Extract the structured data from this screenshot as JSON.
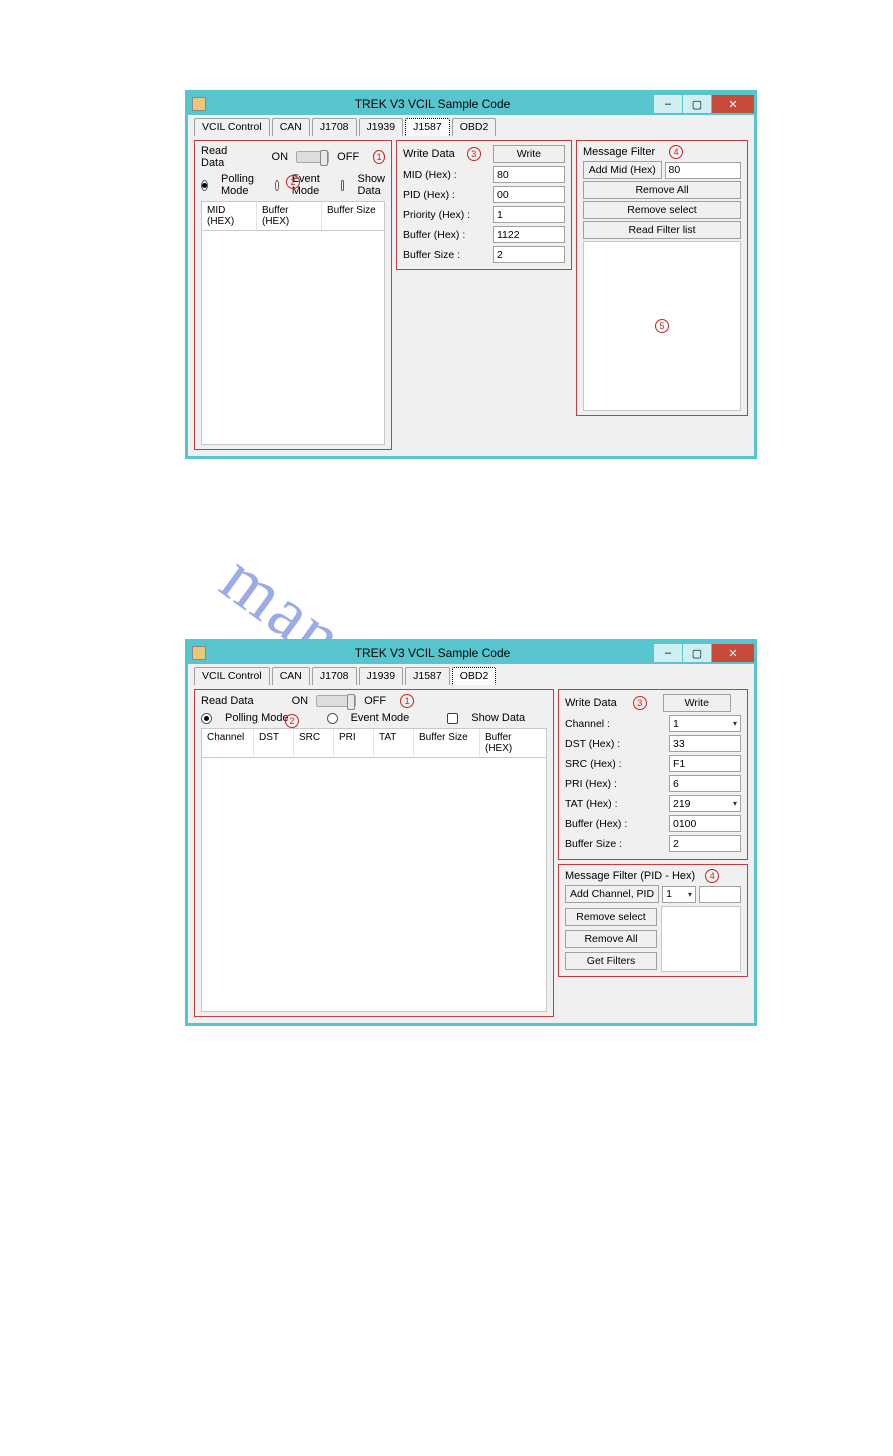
{
  "watermark": "manualshive.com",
  "common": {
    "window_title": "TREK V3 VCIL Sample Code",
    "minimize": "–",
    "maximize": "▢",
    "close": "✕",
    "tabs": [
      "VCIL Control",
      "CAN",
      "J1708",
      "J1939",
      "J1587",
      "OBD2"
    ],
    "on_label": "ON",
    "off_label": "OFF",
    "read_data": "Read Data",
    "polling_mode": "Polling Mode",
    "event_mode": "Event Mode",
    "show_data": "Show Data"
  },
  "win1": {
    "active_tab_index": 4,
    "headers": [
      "MID (HEX)",
      "Buffer (HEX)",
      "Buffer Size"
    ],
    "write_data": {
      "title": "Write Data",
      "write_btn": "Write",
      "fields": {
        "mid": {
          "label": "MID (Hex) :",
          "value": "80"
        },
        "pid": {
          "label": "PID (Hex) :",
          "value": "00"
        },
        "priority": {
          "label": "Priority (Hex) :",
          "value": "1"
        },
        "buffer": {
          "label": "Buffer (Hex) :",
          "value": "1122"
        },
        "buffer_size": {
          "label": "Buffer Size :",
          "value": "2"
        }
      }
    },
    "msg_filter": {
      "title": "Message Filter",
      "add_mid_btn": "Add Mid (Hex)",
      "add_mid_value": "80",
      "remove_all": "Remove All",
      "remove_select": "Remove select",
      "read_filter_list": "Read Filter list"
    },
    "annotations": [
      "1",
      "2",
      "3",
      "4",
      "5"
    ]
  },
  "win2": {
    "active_tab_index": 5,
    "headers": [
      "Channel",
      "DST",
      "SRC",
      "PRI",
      "TAT",
      "Buffer Size",
      "Buffer (HEX)"
    ],
    "write_data": {
      "title": "Write Data",
      "write_btn": "Write",
      "fields": {
        "channel": {
          "label": "Channel :",
          "value": "1",
          "is_select": true
        },
        "dst": {
          "label": "DST (Hex) :",
          "value": "33"
        },
        "src": {
          "label": "SRC (Hex) :",
          "value": "F1"
        },
        "pri": {
          "label": "PRI (Hex) :",
          "value": "6"
        },
        "tat": {
          "label": "TAT (Hex) :",
          "value": "219",
          "is_select": true
        },
        "buffer": {
          "label": "Buffer (Hex) :",
          "value": "0100"
        },
        "buffer_size": {
          "label": "Buffer Size :",
          "value": "2"
        }
      }
    },
    "msg_filter": {
      "title": "Message Filter (PID - Hex)",
      "add_btn": "Add Channel, PID",
      "channel_value": "1",
      "pid_value": "",
      "remove_select": "Remove select",
      "remove_all": "Remove All",
      "get_filters": "Get Filters"
    },
    "annotations": [
      "1",
      "2",
      "3",
      "4"
    ]
  }
}
